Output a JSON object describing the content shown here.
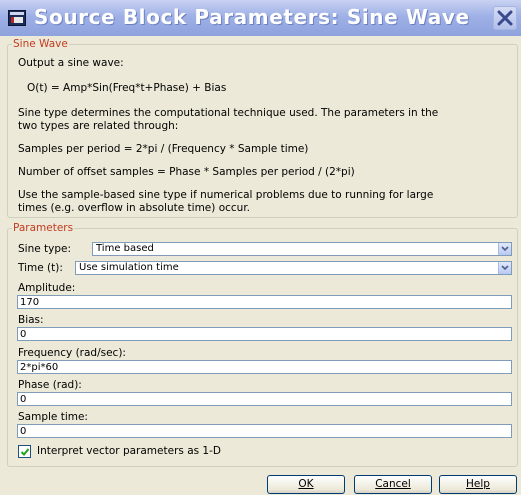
{
  "window": {
    "title": "Source Block Parameters: Sine Wave"
  },
  "description_group": {
    "legend": "Sine Wave",
    "lines": [
      "Output a sine wave:",
      "O(t) = Amp*Sin(Freq*t+Phase) + Bias",
      "Sine type determines the computational technique used. The parameters in the",
      "two types are related through:",
      "Samples per period = 2*pi / (Frequency * Sample time)",
      "Number of offset samples = Phase * Samples per period / (2*pi)",
      "Use the sample-based sine type if numerical problems due to running for large",
      "times (e.g. overflow in absolute time) occur."
    ]
  },
  "parameters_group": {
    "legend": "Parameters",
    "sine_type": {
      "label": "Sine type:",
      "value": "Time based"
    },
    "time": {
      "label": "Time (t):",
      "value": "Use simulation time"
    },
    "amplitude": {
      "label": "Amplitude:",
      "value": "170"
    },
    "bias": {
      "label": "Bias:",
      "value": "0"
    },
    "frequency": {
      "label": "Frequency (rad/sec):",
      "value": "2*pi*60"
    },
    "phase": {
      "label": "Phase (rad):",
      "value": "0"
    },
    "sample_time": {
      "label": "Sample time:",
      "value": "0"
    },
    "interpret_vector": {
      "label": "Interpret vector parameters as 1-D",
      "checked": true
    }
  },
  "buttons": {
    "ok": "OK",
    "cancel": "Cancel",
    "help": "Help"
  }
}
